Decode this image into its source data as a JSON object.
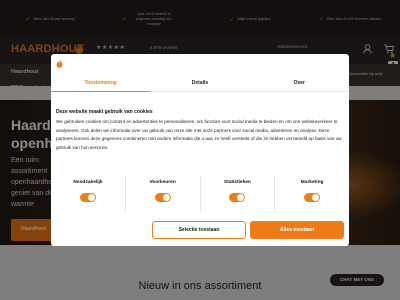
{
  "topbar": {
    "usps": [
      "Meer dan 28 jaar ervaring",
      "Voor 16:00 besteld is volgende werkdag bij u bezorgd",
      "Altijd scherp geprijsd",
      "Meer dan 40.000 tevreden klanten"
    ]
  },
  "header": {
    "logo_text": "HAARDHOUT",
    "stars": "★★★★★",
    "reviews": "4.876 reviews",
    "account_link": "Klantenservice",
    "cart_count": "9",
    "favorite_star": "★"
  },
  "nav": {
    "items": [
      "Haardhout",
      "BBQ producten"
    ],
    "right_text": "Aanmelden bij actie"
  },
  "hero": {
    "title_line1": "Haardhout",
    "title_line2": "openhaard",
    "text": "Een ruim assortiment openhaardhout, geniet van de warmte",
    "button": "Haardhout"
  },
  "section": {
    "new_title": "Nieuw in ons assortiment"
  },
  "chat": {
    "label": "CHAT MET ONS"
  },
  "cookie": {
    "tabs": [
      "Toestemming",
      "Details",
      "Over"
    ],
    "active_tab": "Toestemming",
    "heading": "Deze website maakt gebruik van cookies",
    "body": "We gebruiken cookies om content en advertenties te personaliseren, om functies voor social media te bieden en om ons websiteverkeer te analyseren. Ook delen we informatie over uw gebruik van onze site met onze partners voor social media, adverteren en analyse. Deze partners kunnen deze gegevens combineren met andere informatie die u aan ze heeft verstrekt of die ze hebben verzameld op basis van uw gebruik van hun services.",
    "categories": [
      "Noodzakelijk",
      "Voorkeuren",
      "Statistieken",
      "Marketing"
    ],
    "toggles_on": [
      true,
      true,
      true,
      true
    ],
    "select_button": "Selectie toestaan",
    "allow_all_button": "Alles toestaan"
  },
  "colors": {
    "accent": "#f07b19",
    "dark": "#211d1b"
  }
}
